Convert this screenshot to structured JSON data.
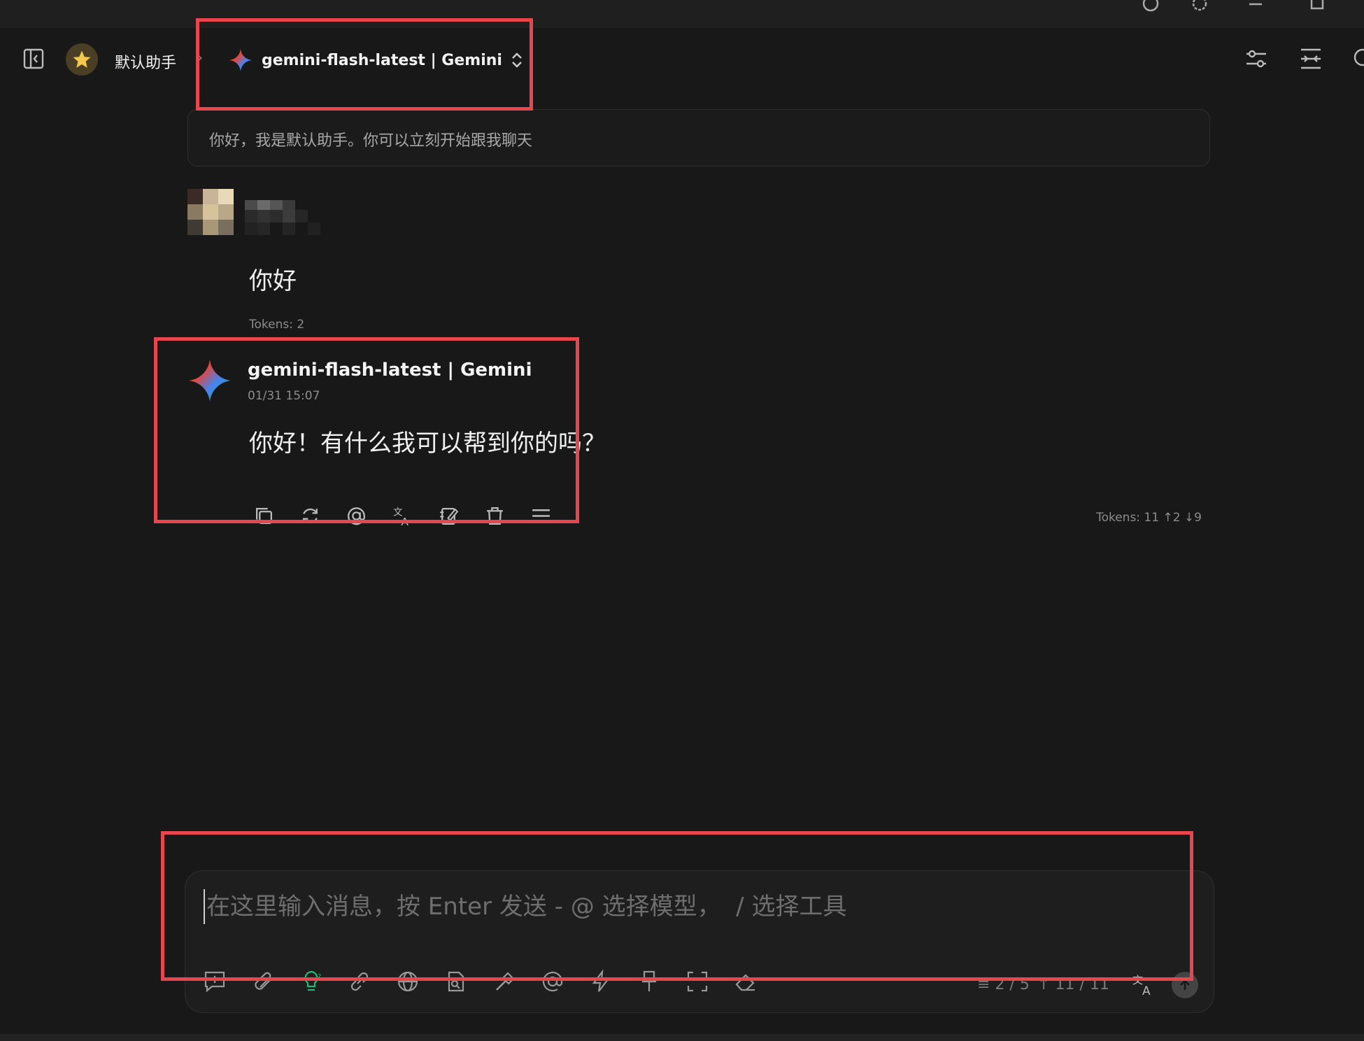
{
  "header": {
    "assistant_name": "默认助手",
    "model_label": "gemini-flash-latest | Gemini"
  },
  "prompt": {
    "text": "你好，我是默认助手。你可以立刻开始跟我聊天"
  },
  "messages": [
    {
      "role": "user",
      "content": "你好",
      "tokens": "Tokens: 2"
    },
    {
      "role": "assistant",
      "model": "gemini-flash-latest | Gemini",
      "time": "01/31 15:07",
      "content": "你好！有什么我可以帮到你的吗？",
      "tokens": "Tokens: 11 ↑2 ↓9"
    }
  ],
  "message_actions": [
    "copy-icon",
    "regenerate-icon",
    "mention-icon",
    "translate-icon",
    "edit-icon",
    "delete-icon",
    "menu-icon"
  ],
  "composer": {
    "placeholder": "在这里输入消息，按 Enter 发送 - @ 选择模型，  / 选择工具",
    "context_count": "≡ 2 / 5",
    "token_count": "↑ 11 / 11",
    "tools": [
      "new-topic-icon",
      "attachment-icon",
      "thinking-icon",
      "link-icon",
      "web-search-icon",
      "knowledge-icon",
      "hammer-icon",
      "mention-icon",
      "quick-phrase-icon",
      "clear-icon",
      "expand-icon",
      "eraser-icon"
    ]
  },
  "colors": {
    "background": "#181818",
    "highlight_box": "#e8464e",
    "thinking_icon": "#2bb673"
  }
}
